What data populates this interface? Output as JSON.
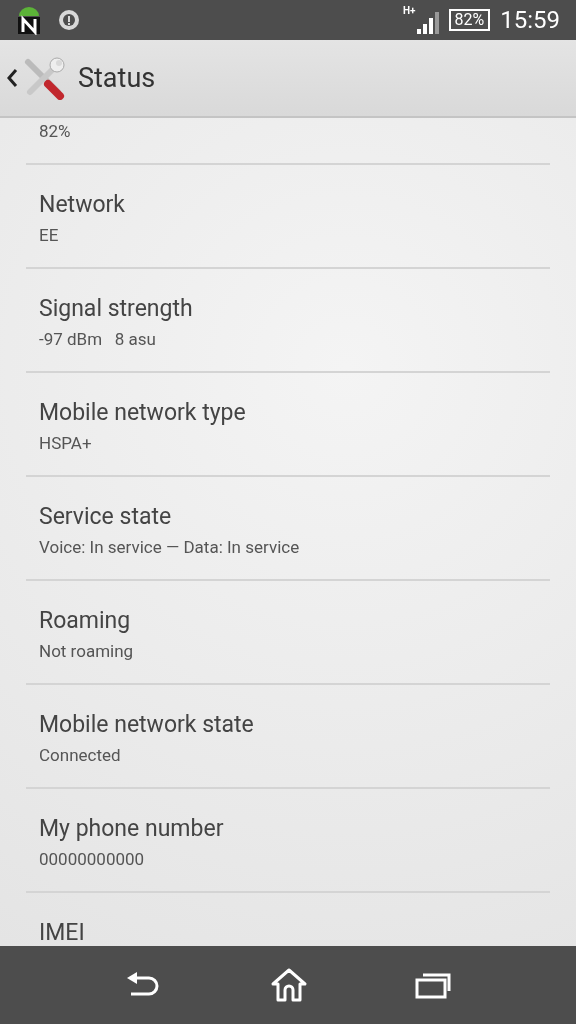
{
  "status_bar": {
    "network_type": "H+",
    "battery": "82%",
    "time": "15:59"
  },
  "header": {
    "title": "Status"
  },
  "items": [
    {
      "value": "82%"
    },
    {
      "title": "Network",
      "value": "EE"
    },
    {
      "title": "Signal strength",
      "value": "-97 dBm   8 asu"
    },
    {
      "title": "Mobile network type",
      "value": "HSPA+"
    },
    {
      "title": "Service state",
      "value": "Voice: In service — Data: In service"
    },
    {
      "title": "Roaming",
      "value": "Not roaming"
    },
    {
      "title": "Mobile network state",
      "value": "Connected"
    },
    {
      "title": "My phone number",
      "value": "00000000000"
    },
    {
      "title": "IMEI"
    }
  ]
}
